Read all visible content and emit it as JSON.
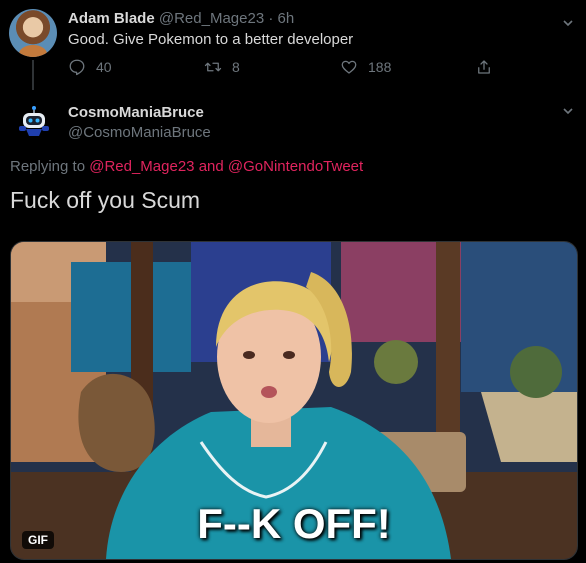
{
  "tweet1": {
    "name": "Adam Blade",
    "handle": "@Red_Mage23",
    "separator": "·",
    "time": "6h",
    "text": "Good. Give Pokemon to a better developer",
    "actions": {
      "reply_count": "40",
      "retweet_count": "8",
      "like_count": "188"
    }
  },
  "tweet2": {
    "name": "CosmoManiaBruce",
    "handle": "@CosmoManiaBruce",
    "replying_prefix": "Replying to",
    "mention1": "@Red_Mage23",
    "connector": "and",
    "mention2": "@GoNintendoTweet",
    "text": "Fuck off you Scum",
    "media": {
      "badge": "GIF",
      "caption": "F--K OFF!"
    }
  },
  "icons": {
    "reply": "reply-icon",
    "retweet": "retweet-icon",
    "like": "heart-icon",
    "share": "share-icon",
    "more": "chevron-down-icon"
  },
  "colors": {
    "background": "#000000",
    "text": "#d9d9d9",
    "muted": "#6e767d",
    "mention": "#e0245e",
    "divider": "#2f3336"
  }
}
